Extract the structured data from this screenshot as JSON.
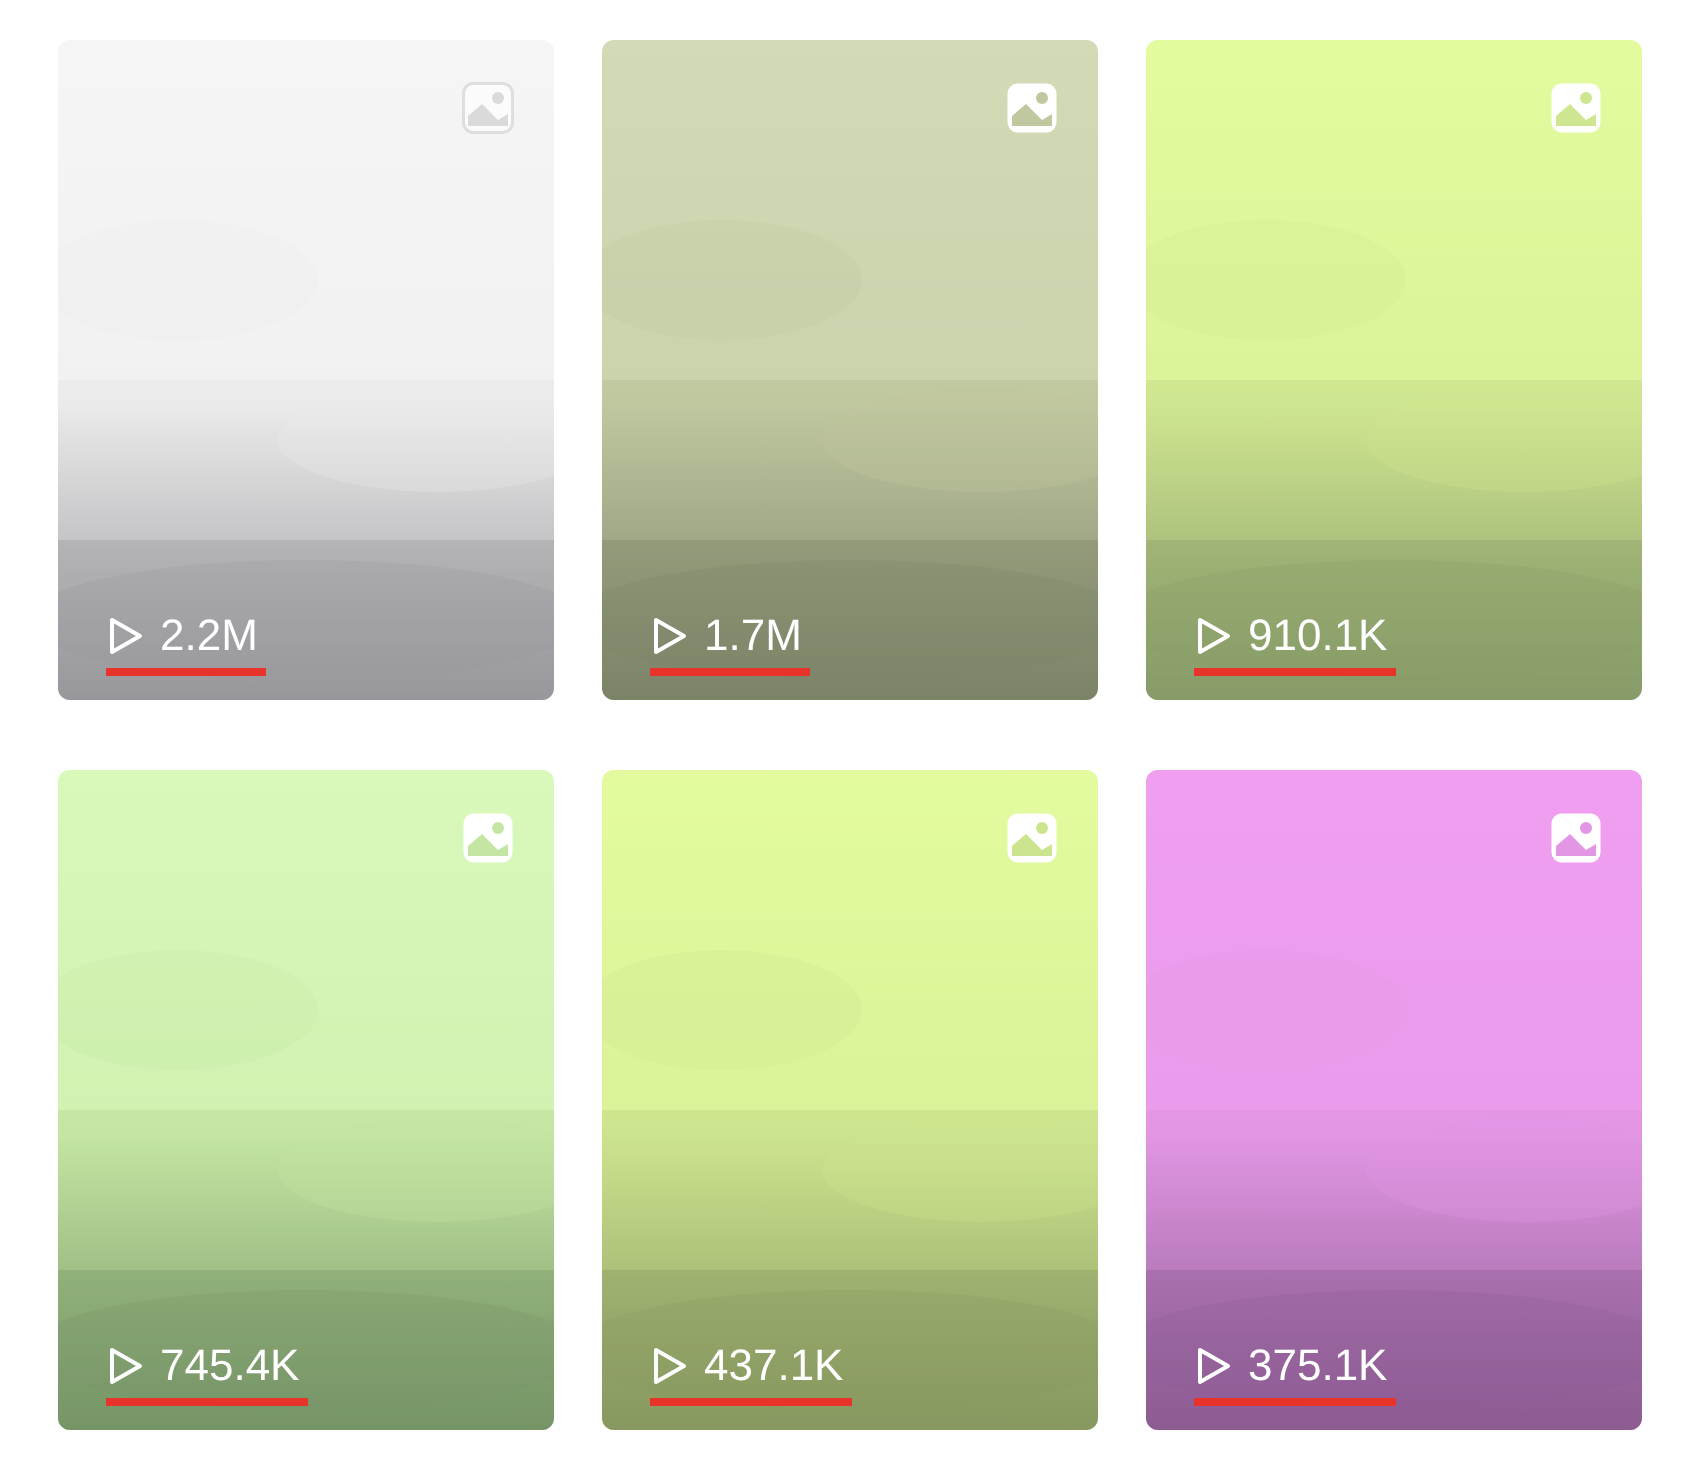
{
  "videos": [
    {
      "views": "2.2M"
    },
    {
      "views": "1.7M"
    },
    {
      "views": "910.1K"
    },
    {
      "views": "745.4K"
    },
    {
      "views": "437.1K"
    },
    {
      "views": "375.1K"
    }
  ]
}
